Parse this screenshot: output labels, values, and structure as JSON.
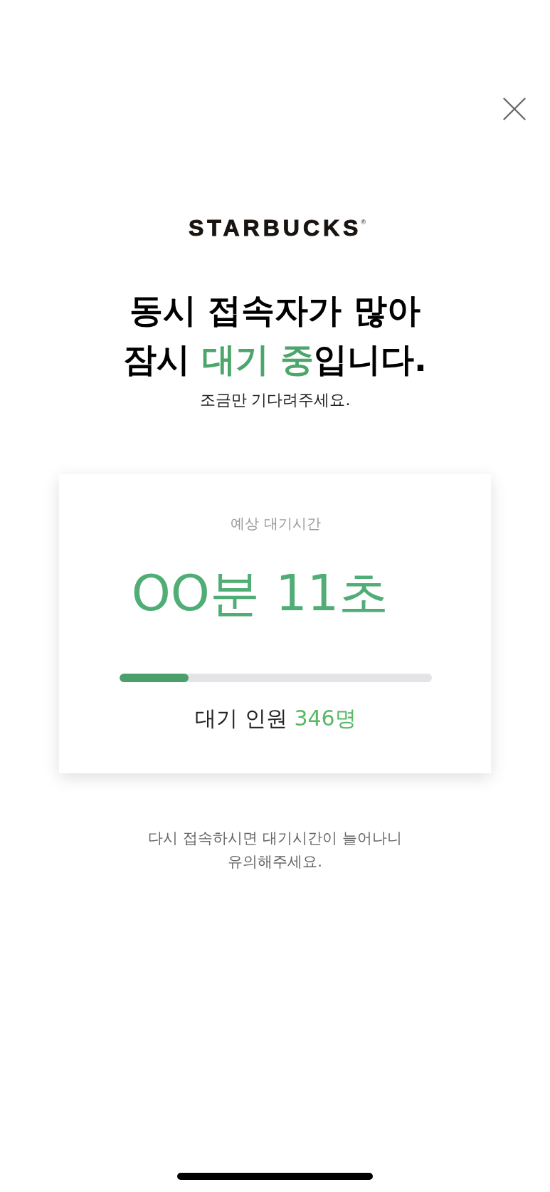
{
  "logo": "STARBUCKS$^{®}$",
  "headline": [
    [
      {
        "text": "동시 접속자가 많아",
        "highlight": false
      }
    ],
    [
      {
        "text": "잠시 ",
        "highlight": false
      },
      {
        "text": "대기 중",
        "highlight": true
      },
      {
        "text": "입니다.",
        "highlight": false
      }
    ]
  ],
  "subtitle": "조금만 기다려주세요.",
  "wait_card": {
    "label": "예상 대기시간",
    "time": "OO분 11초",
    "progress": {
      "level": 0.22
    },
    "queue": {
      "label": "대기 인원",
      "count": "346명"
    }
  },
  "notice": [
    "다시 접속하시면 대기시간이 늘어나니",
    "유의해주세요."
  ]
}
